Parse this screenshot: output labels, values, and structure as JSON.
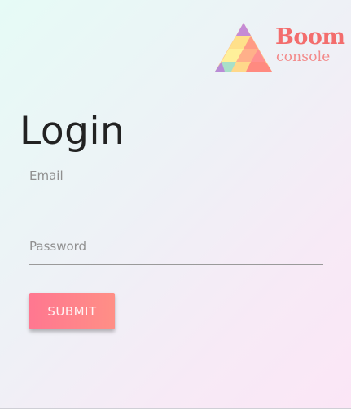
{
  "brand": {
    "name": "Boom",
    "tagline": "console",
    "icon": "triangle-logo-icon"
  },
  "page": {
    "title": "Login"
  },
  "form": {
    "email": {
      "placeholder": "Email",
      "value": ""
    },
    "password": {
      "placeholder": "Password",
      "value": ""
    },
    "submit_label": "SUBMIT"
  },
  "colors": {
    "accent_start": "#ff7790",
    "accent_end": "#ff8f86",
    "brand_text": "#f36d6d"
  }
}
